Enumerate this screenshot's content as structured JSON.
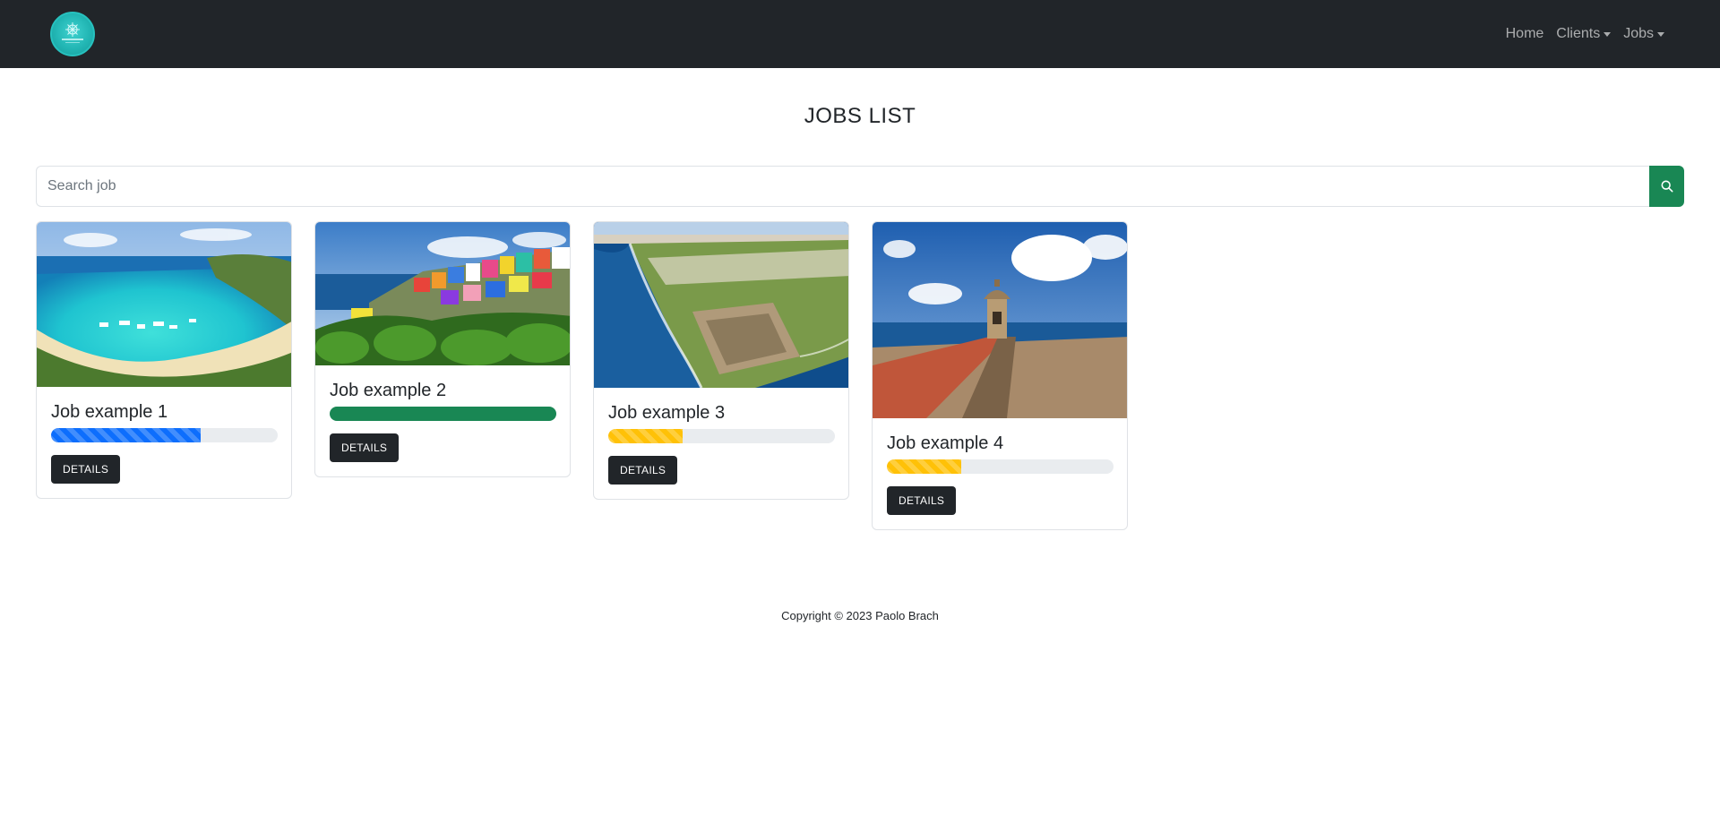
{
  "navbar": {
    "logo_icon": "company-logo",
    "links": [
      {
        "label": "Home",
        "dropdown": false
      },
      {
        "label": "Clients",
        "dropdown": true
      },
      {
        "label": "Jobs",
        "dropdown": true
      }
    ]
  },
  "page": {
    "title": "JOBS LIST"
  },
  "search": {
    "placeholder": "Search job",
    "value": "",
    "button_icon": "search-icon"
  },
  "jobs": [
    {
      "title": "Job example 1",
      "progress_percent": 66,
      "progress_color": "#0d6efd",
      "striped": true,
      "details_label": "DETAILS",
      "image_alt": "Tropical beach bay with boats"
    },
    {
      "title": "Job example 2",
      "progress_percent": 100,
      "progress_color": "#198754",
      "striped": false,
      "details_label": "DETAILS",
      "image_alt": "Colorful houses on hillside"
    },
    {
      "title": "Job example 3",
      "progress_percent": 33,
      "progress_color": "#ffc107",
      "striped": true,
      "details_label": "DETAILS",
      "image_alt": "Aerial view of coastal fort"
    },
    {
      "title": "Job example 4",
      "progress_percent": 33,
      "progress_color": "#ffc107",
      "striped": true,
      "details_label": "DETAILS",
      "image_alt": "Sentry box on fort wall by the sea"
    }
  ],
  "footer": {
    "copyright": "Copyright © 2023 Paolo Brach"
  },
  "colors": {
    "navbar_bg": "#212529",
    "search_button": "#198754",
    "details_button": "#212529"
  }
}
